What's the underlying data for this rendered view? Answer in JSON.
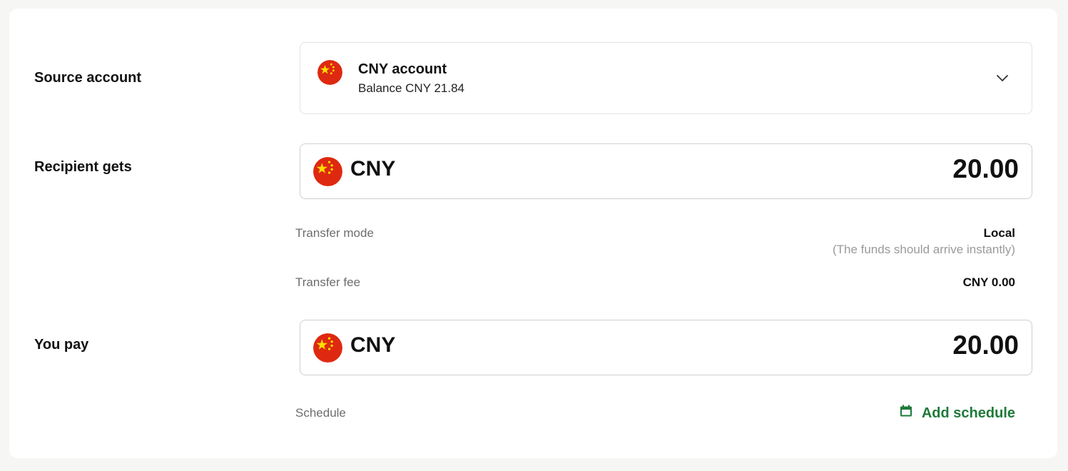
{
  "source": {
    "label": "Source account",
    "account_name": "CNY account",
    "balance": "Balance CNY 21.84",
    "flag_icon": "china-flag-icon"
  },
  "recipient": {
    "label": "Recipient gets",
    "currency": "CNY",
    "amount": "20.00"
  },
  "transfer": {
    "mode_label": "Transfer mode",
    "mode_value": "Local",
    "mode_note": "(The funds should arrive instantly)",
    "fee_label": "Transfer fee",
    "fee_value": "CNY 0.00"
  },
  "pay": {
    "label": "You pay",
    "currency": "CNY",
    "amount": "20.00"
  },
  "schedule": {
    "label": "Schedule",
    "action": "Add schedule",
    "action_color": "#1f7a3a"
  },
  "colors": {
    "flag_red": "#de2910",
    "flag_star": "#ffde00"
  }
}
